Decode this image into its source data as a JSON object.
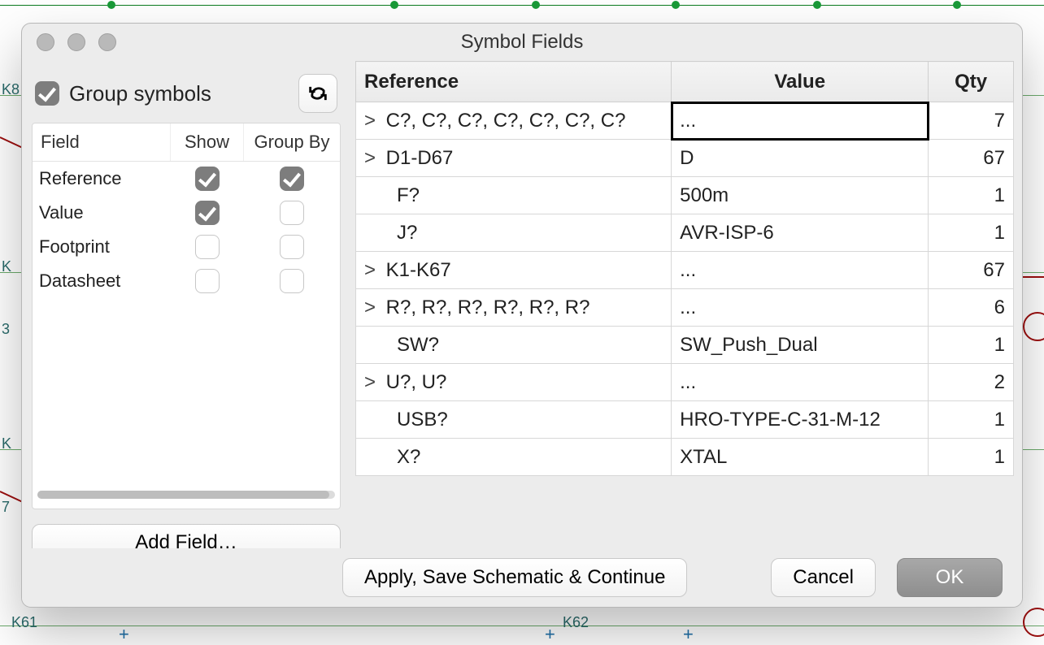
{
  "window": {
    "title": "Symbol Fields"
  },
  "group_symbols": {
    "label": "Group symbols",
    "checked": true
  },
  "field_panel": {
    "headers": {
      "field": "Field",
      "show": "Show",
      "groupby": "Group By"
    },
    "rows": [
      {
        "name": "Reference",
        "show": true,
        "groupby": true
      },
      {
        "name": "Value",
        "show": true,
        "groupby": false
      },
      {
        "name": "Footprint",
        "show": false,
        "groupby": false
      },
      {
        "name": "Datasheet",
        "show": false,
        "groupby": false
      }
    ],
    "add_button": "Add Field…"
  },
  "grid": {
    "headers": {
      "reference": "Reference",
      "value": "Value",
      "qty": "Qty"
    },
    "rows": [
      {
        "expand": ">",
        "reference": "C?, C?, C?, C?, C?, C?, C?",
        "value": "...",
        "qty": "7",
        "value_selected": true
      },
      {
        "expand": ">",
        "reference": "D1-D67",
        "value": "D",
        "qty": "67"
      },
      {
        "expand": "",
        "reference": "F?",
        "value": "500m",
        "qty": "1"
      },
      {
        "expand": "",
        "reference": "J?",
        "value": "AVR-ISP-6",
        "qty": "1"
      },
      {
        "expand": ">",
        "reference": "K1-K67",
        "value": "...",
        "qty": "67"
      },
      {
        "expand": ">",
        "reference": "R?, R?, R?, R?, R?, R?",
        "value": "...",
        "qty": "6"
      },
      {
        "expand": "",
        "reference": "SW?",
        "value": "SW_Push_Dual",
        "qty": "1"
      },
      {
        "expand": ">",
        "reference": "U?, U?",
        "value": "...",
        "qty": "2"
      },
      {
        "expand": "",
        "reference": "USB?",
        "value": "HRO-TYPE-C-31-M-12",
        "qty": "1"
      },
      {
        "expand": "",
        "reference": "X?",
        "value": "XTAL",
        "qty": "1"
      }
    ]
  },
  "footer": {
    "apply": "Apply, Save Schematic & Continue",
    "cancel": "Cancel",
    "ok": "OK"
  },
  "bg_labels": {
    "k61": "K61",
    "k62": "K62",
    "k8": "K8",
    "s3": "3",
    "s7": "7"
  }
}
